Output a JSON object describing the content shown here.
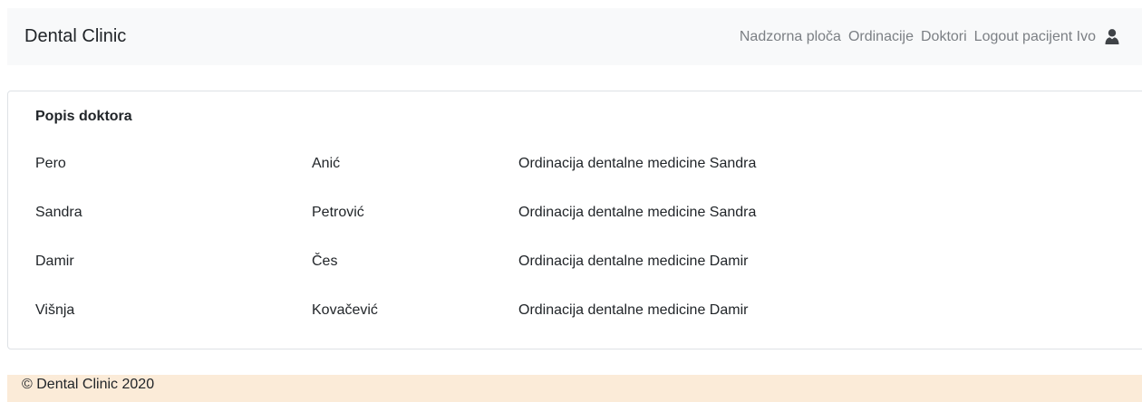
{
  "navbar": {
    "brand": "Dental Clinic",
    "links": [
      {
        "label": "Nadzorna ploča"
      },
      {
        "label": "Ordinacije"
      },
      {
        "label": "Doktori"
      },
      {
        "label": "Logout pacijent Ivo"
      }
    ],
    "user_icon": "user-icon"
  },
  "doctors_card": {
    "title": "Popis doktora",
    "rows": [
      {
        "first_name": "Pero",
        "last_name": "Anić",
        "clinic": "Ordinacija dentalne medicine Sandra"
      },
      {
        "first_name": "Sandra",
        "last_name": "Petrović",
        "clinic": "Ordinacija dentalne medicine Sandra"
      },
      {
        "first_name": "Damir",
        "last_name": "Čes",
        "clinic": "Ordinacija dentalne medicine Damir"
      },
      {
        "first_name": "Višnja",
        "last_name": "Kovačević",
        "clinic": "Ordinacija dentalne medicine Damir"
      }
    ]
  },
  "footer": {
    "text": "© Dental Clinic 2020"
  },
  "colors": {
    "navbar_bg": "#f8f9fa",
    "nav_link": "#7b7f84",
    "footer_bg": "#fbebd8",
    "text": "#212529",
    "card_border": "#dee2e6"
  }
}
